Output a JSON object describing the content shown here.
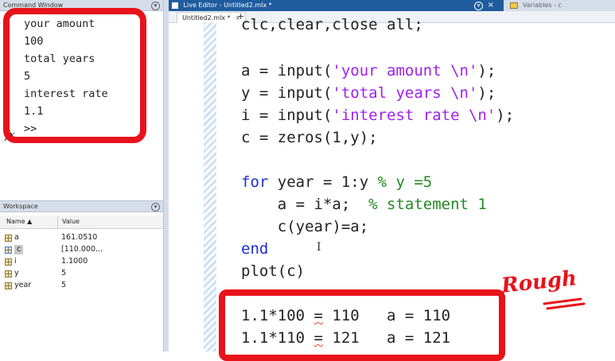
{
  "command_window": {
    "title": "Command Window",
    "lines": [
      "your amount",
      "100",
      "total years",
      "5",
      "interest rate",
      "1.1",
      ">>"
    ],
    "fx_label": "fx"
  },
  "workspace": {
    "title": "Workspace",
    "columns": [
      "Name ▲",
      "Value"
    ],
    "variables": [
      {
        "name": "a",
        "value": "161.0510",
        "icon": "scalar-icon"
      },
      {
        "name": "c",
        "value": "[110.000...",
        "icon": "matrix-icon"
      },
      {
        "name": "i",
        "value": "1.1000",
        "icon": "scalar-icon"
      },
      {
        "name": "y",
        "value": "5",
        "icon": "scalar-icon"
      },
      {
        "name": "year",
        "value": "5",
        "icon": "scalar-icon"
      }
    ]
  },
  "editor": {
    "title": "Live Editor - Untitled2.mlx *",
    "variables_tab": "Variables - c",
    "tab_label": "Untitled2.mlx *",
    "tab_close": "×",
    "new_tab": "+",
    "code_lines": [
      {
        "parts": [
          {
            "t": "clc,clear,close all;",
            "c": "plain"
          }
        ]
      },
      {
        "parts": [
          {
            "t": "a = input(",
            "c": "plain"
          },
          {
            "t": "'your amount \\n'",
            "c": "str"
          },
          {
            "t": ");",
            "c": "plain"
          }
        ]
      },
      {
        "parts": [
          {
            "t": "y = input(",
            "c": "plain"
          },
          {
            "t": "'total years \\n'",
            "c": "str"
          },
          {
            "t": ");",
            "c": "plain"
          }
        ]
      },
      {
        "parts": [
          {
            "t": "i = input(",
            "c": "plain"
          },
          {
            "t": "'interest rate \\n'",
            "c": "str"
          },
          {
            "t": ");",
            "c": "plain"
          }
        ]
      },
      {
        "parts": [
          {
            "t": "c = zeros(1,y);",
            "c": "plain"
          }
        ]
      },
      {
        "parts": [
          {
            "t": "for",
            "c": "kw"
          },
          {
            "t": " year = 1:y ",
            "c": "plain"
          },
          {
            "t": "% y =5",
            "c": "cm"
          }
        ]
      },
      {
        "parts": [
          {
            "t": "    a = i*a;  ",
            "c": "plain"
          },
          {
            "t": "% statement 1",
            "c": "cm"
          }
        ]
      },
      {
        "parts": [
          {
            "t": "    c(year)=a;",
            "c": "plain"
          }
        ]
      },
      {
        "parts": [
          {
            "t": "end",
            "c": "kw"
          }
        ]
      },
      {
        "parts": [
          {
            "t": "plot(c)",
            "c": "plain"
          }
        ]
      },
      {
        "parts": [
          {
            "t": "1.1*100 ",
            "c": "plain"
          },
          {
            "t": "=",
            "c": "squig"
          },
          {
            "t": " 110   a = 110",
            "c": "plain"
          }
        ]
      },
      {
        "parts": [
          {
            "t": "1.1*110 ",
            "c": "plain"
          },
          {
            "t": "=",
            "c": "squig"
          },
          {
            "t": " 121   a = 121",
            "c": "plain"
          }
        ]
      }
    ]
  },
  "annotation": {
    "text": "Rough",
    "color": "#e8121a"
  },
  "colors": {
    "keyword": "#1a2fd0",
    "string": "#a020f0",
    "comment": "#228b22",
    "editor_titlebar": "#1f5c9e"
  }
}
